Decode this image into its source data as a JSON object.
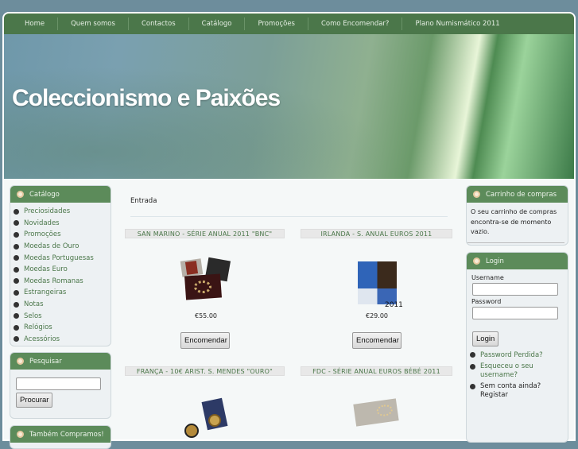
{
  "nav": [
    "Home",
    "Quem somos",
    "Contactos",
    "Catálogo",
    "Promoções",
    "Como Encomendar?",
    "Plano Numismático 2011"
  ],
  "site_title": "Coleccionismo e Paixões",
  "catalog": {
    "title": "Catálogo",
    "items": [
      "Preciosidades",
      "Novidades",
      "Promoções",
      "Moedas de Ouro",
      "Moedas Portuguesas",
      "Moedas Euro",
      "Moedas Romanas",
      "Estrangeiras",
      "Notas",
      "Selos",
      "Relógios",
      "Acessórios"
    ]
  },
  "search": {
    "title": "Pesquisar",
    "value": "",
    "button": "Procurar"
  },
  "buy": {
    "title": "Também Compramos!"
  },
  "cart": {
    "title": "Carrinho de compras",
    "text": "O seu carrinho de compras encontra-se de momento vazio."
  },
  "login": {
    "title": "Login",
    "username_label": "Username",
    "password_label": "Password",
    "button": "Login",
    "links": [
      "Password Perdida?",
      "Esqueceu o seu username?",
      "Sem conta ainda? Registar"
    ]
  },
  "main": {
    "heading": "Entrada",
    "order_label": "Encomendar",
    "products": [
      {
        "title": "SAN MARINO - SÉRIE ANUAL 2011 \"BNC\"",
        "price": "€55.00"
      },
      {
        "title": "IRLANDA - S. ANUAL EUROS 2011",
        "price": "€29.00",
        "caption": "2011"
      },
      {
        "title": "FRANÇA - 10€ ARIST. S. MENDES \"OURO\""
      },
      {
        "title": "FDC - SÉRIE ANUAL EUROS BÉBÉ 2011"
      }
    ]
  }
}
